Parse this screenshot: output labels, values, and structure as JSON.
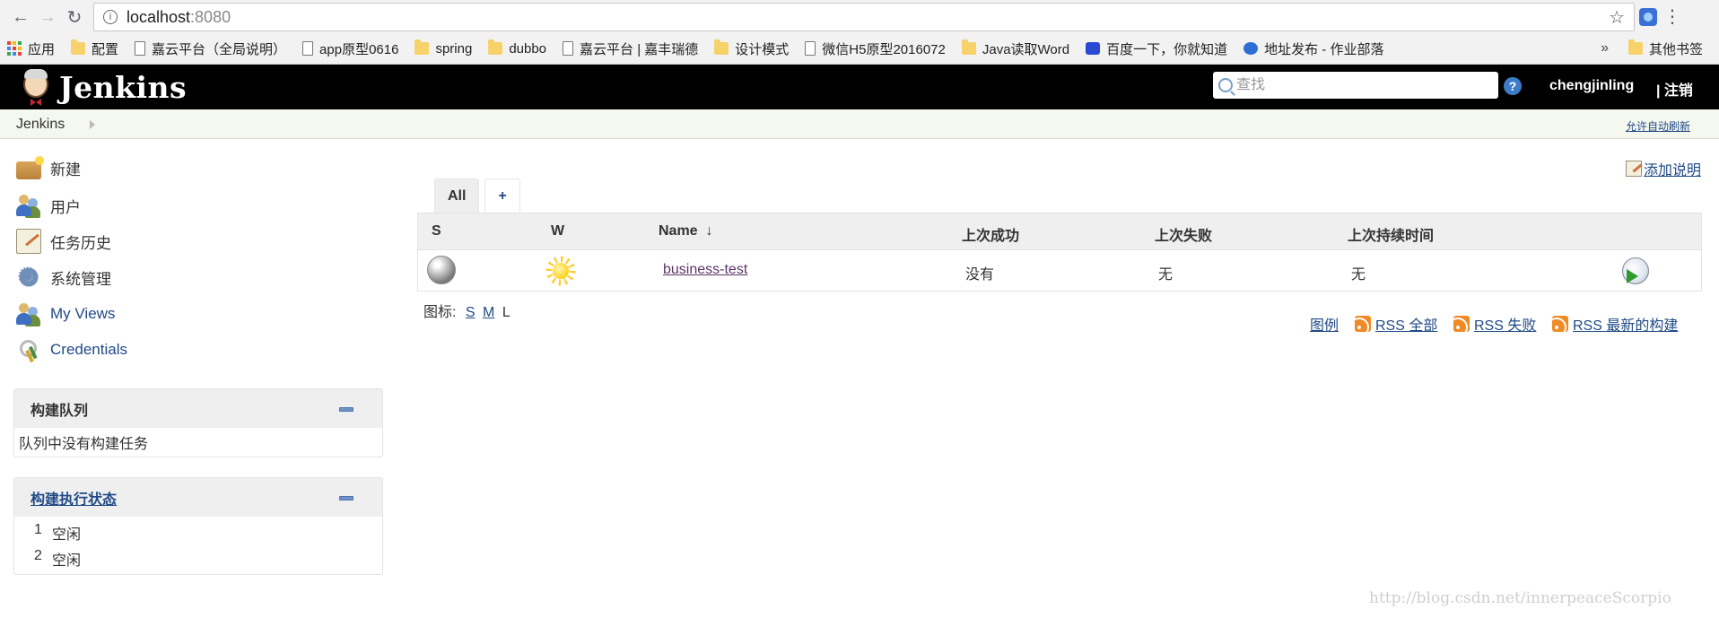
{
  "browser": {
    "url_host": "localhost",
    "url_port": ":8080",
    "bookmarks": [
      {
        "label": "应用",
        "icon": "apps-icon"
      },
      {
        "label": "配置",
        "icon": "folder-icon"
      },
      {
        "label": "嘉云平台（全局说明）",
        "icon": "page-icon"
      },
      {
        "label": "app原型0616",
        "icon": "page-icon"
      },
      {
        "label": "spring",
        "icon": "folder-icon"
      },
      {
        "label": "dubbo",
        "icon": "folder-icon"
      },
      {
        "label": "嘉云平台 | 嘉丰瑞德",
        "icon": "page-icon"
      },
      {
        "label": "设计模式",
        "icon": "folder-icon"
      },
      {
        "label": "微信H5原型2016072",
        "icon": "page-icon"
      },
      {
        "label": "Java读取Word",
        "icon": "folder-icon"
      },
      {
        "label": "百度一下，你就知道",
        "icon": "paw-icon"
      },
      {
        "label": "地址发布 - 作业部落",
        "icon": "circle-e-icon"
      }
    ],
    "more": "»",
    "other_bookmarks": "其他书签"
  },
  "header": {
    "logo_text": "Jenkins",
    "search_placeholder": "查找",
    "help": "?",
    "username": "chengjinling",
    "logout": "| 注销"
  },
  "breadcrumb": {
    "root": "Jenkins",
    "auto_refresh": "允许自动刷新"
  },
  "sidebar": {
    "tasks": [
      {
        "label": "新建",
        "icon": "new-item-icon"
      },
      {
        "label": "用户",
        "icon": "people-icon"
      },
      {
        "label": "任务历史",
        "icon": "notepad-icon"
      },
      {
        "label": "系统管理",
        "icon": "gear-icon"
      },
      {
        "label": "My Views",
        "icon": "people-icon"
      },
      {
        "label": "Credentials",
        "icon": "keys-icon"
      }
    ],
    "build_queue": {
      "title": "构建队列",
      "empty": "队列中没有构建任务"
    },
    "executors": {
      "title": "构建执行状态",
      "items": [
        {
          "num": "1",
          "status": "空闲"
        },
        {
          "num": "2",
          "status": "空闲"
        }
      ]
    }
  },
  "main": {
    "add_description": "添加说明",
    "tabs": [
      {
        "label": "All",
        "active": true
      },
      {
        "label": "+",
        "active": false
      }
    ],
    "table": {
      "headers": {
        "s": "S",
        "w": "W",
        "name": "Name",
        "sort": "↓",
        "last_success": "上次成功",
        "last_failure": "上次失败",
        "last_duration": "上次持续时间"
      },
      "rows": [
        {
          "status_icon": "grey-ball-icon",
          "weather_icon": "sunny-icon",
          "name": "business-test",
          "last_success": "没有",
          "last_failure": "无",
          "last_duration": "无",
          "action_icon": "schedule-build-icon"
        }
      ]
    },
    "icon_size": {
      "label": "图标:",
      "s": "S",
      "m": "M",
      "l": "L"
    },
    "footer_links": {
      "legend": "图例",
      "rss_all": "RSS 全部",
      "rss_failed": "RSS 失败",
      "rss_latest": "RSS 最新的构建"
    }
  },
  "watermark": "http://blog.csdn.net/innerpeaceScorpio"
}
